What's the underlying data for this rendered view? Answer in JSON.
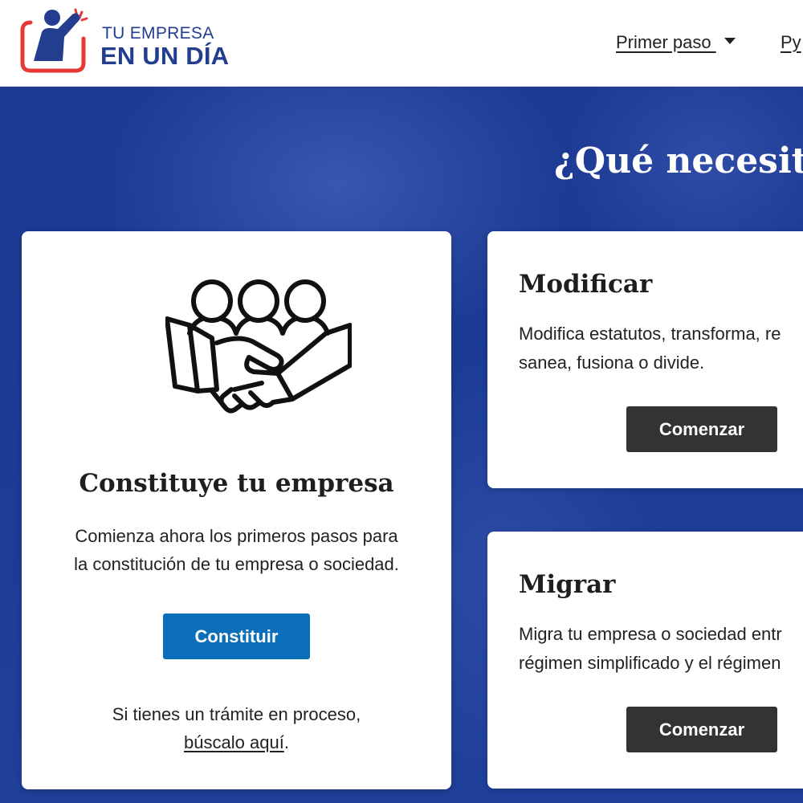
{
  "header": {
    "logo": {
      "line1": "TU EMPRESA",
      "line2": "EN UN DÍA",
      "icon": "person-raising-hand-icon"
    },
    "nav": [
      {
        "label": "Primer paso ",
        "has_dropdown": true
      },
      {
        "label": "Py"
      }
    ]
  },
  "hero": {
    "title": "¿Qué necesita"
  },
  "cards": {
    "constituye": {
      "icon": "handshake-group-icon",
      "title": "Constituye tu empresa",
      "desc_line1": "Comienza ahora los primeros pasos para",
      "desc_line2": "la constitución de tu empresa o sociedad.",
      "button": "Constituir",
      "note_line1": "Si tienes un trámite en proceso,",
      "note_link": "búscalo aquí",
      "note_end": "."
    },
    "modificar": {
      "title": "Modificar",
      "desc_line1": "Modifica estatutos, transforma, re",
      "desc_line2": "sanea, fusiona o divide.",
      "button": "Comenzar"
    },
    "migrar": {
      "title": "Migrar",
      "desc_line1": "Migra tu empresa o sociedad entr",
      "desc_line2": "régimen simplificado y el régimen",
      "button": "Comenzar"
    }
  },
  "colors": {
    "brand_blue": "#233d8f",
    "logo_red": "#e53935",
    "primary_button": "#0a6fb8",
    "dark_button": "#333333",
    "hero_bg": "#1f3a8f"
  }
}
